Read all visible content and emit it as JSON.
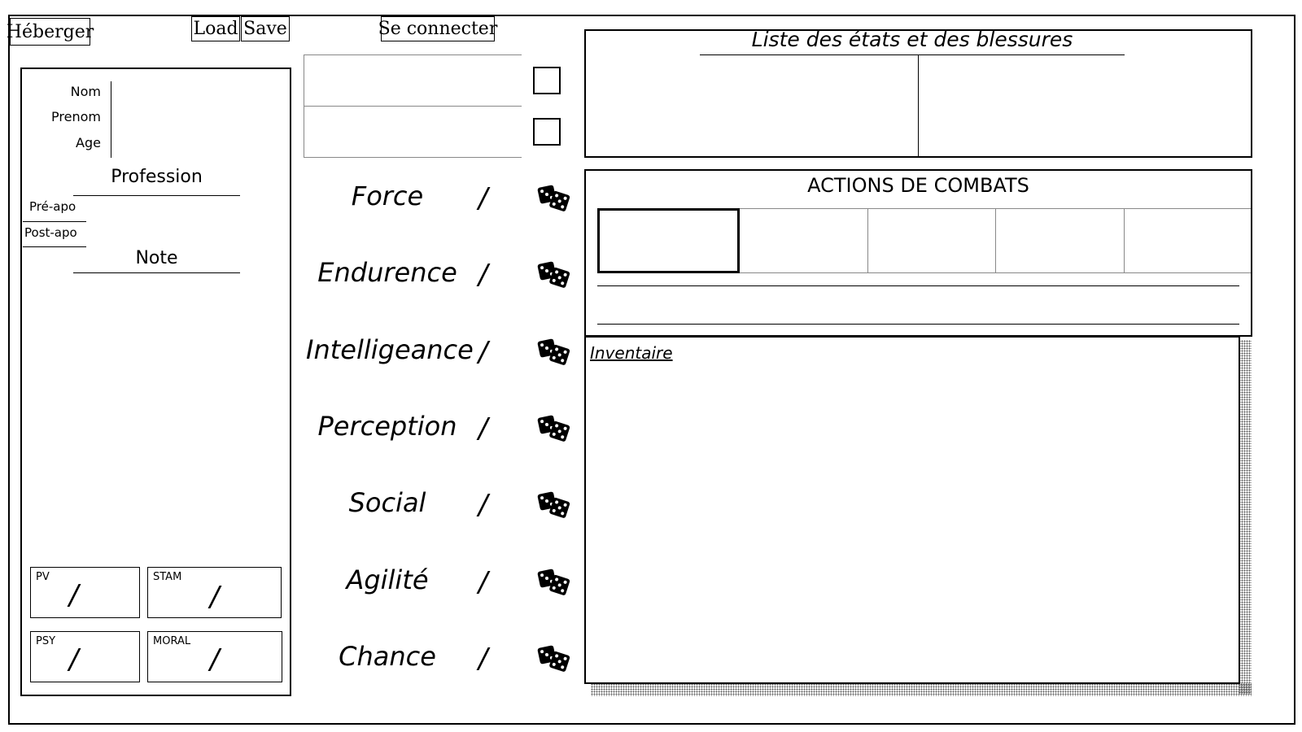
{
  "toolbar": {
    "host_label": "Héberger",
    "load_label": "Load",
    "save_label": "Save",
    "connect_label": "Se connecter"
  },
  "identity": {
    "nom_label": "Nom",
    "prenom_label": "Prenom",
    "age_label": "Age",
    "profession_title": "Profession",
    "pre_apo_label": "Pré-apo",
    "post_apo_label": "Post-apo",
    "note_title": "Note"
  },
  "vitals": [
    {
      "label": "PV",
      "slash": "/"
    },
    {
      "label": "STAM",
      "slash": "/"
    },
    {
      "label": "PSY",
      "slash": "/"
    },
    {
      "label": "MORAL",
      "slash": "/"
    }
  ],
  "attributes": [
    {
      "name": "Force",
      "slash": "/",
      "icon": "dice-icon"
    },
    {
      "name": "Endurence",
      "slash": "/",
      "icon": "dice-icon"
    },
    {
      "name": "Intelligeance",
      "slash": "/",
      "icon": "dice-icon"
    },
    {
      "name": "Perception",
      "slash": "/",
      "icon": "dice-icon"
    },
    {
      "name": "Social",
      "slash": "/",
      "icon": "dice-icon"
    },
    {
      "name": "Agilité",
      "slash": "/",
      "icon": "dice-icon"
    },
    {
      "name": "Chance",
      "slash": "/",
      "icon": "dice-icon"
    }
  ],
  "states": {
    "title": "Liste des états et des blessures"
  },
  "combat": {
    "title": "ACTIONS DE COMBATS"
  },
  "inventory": {
    "label": "Inventaire"
  }
}
